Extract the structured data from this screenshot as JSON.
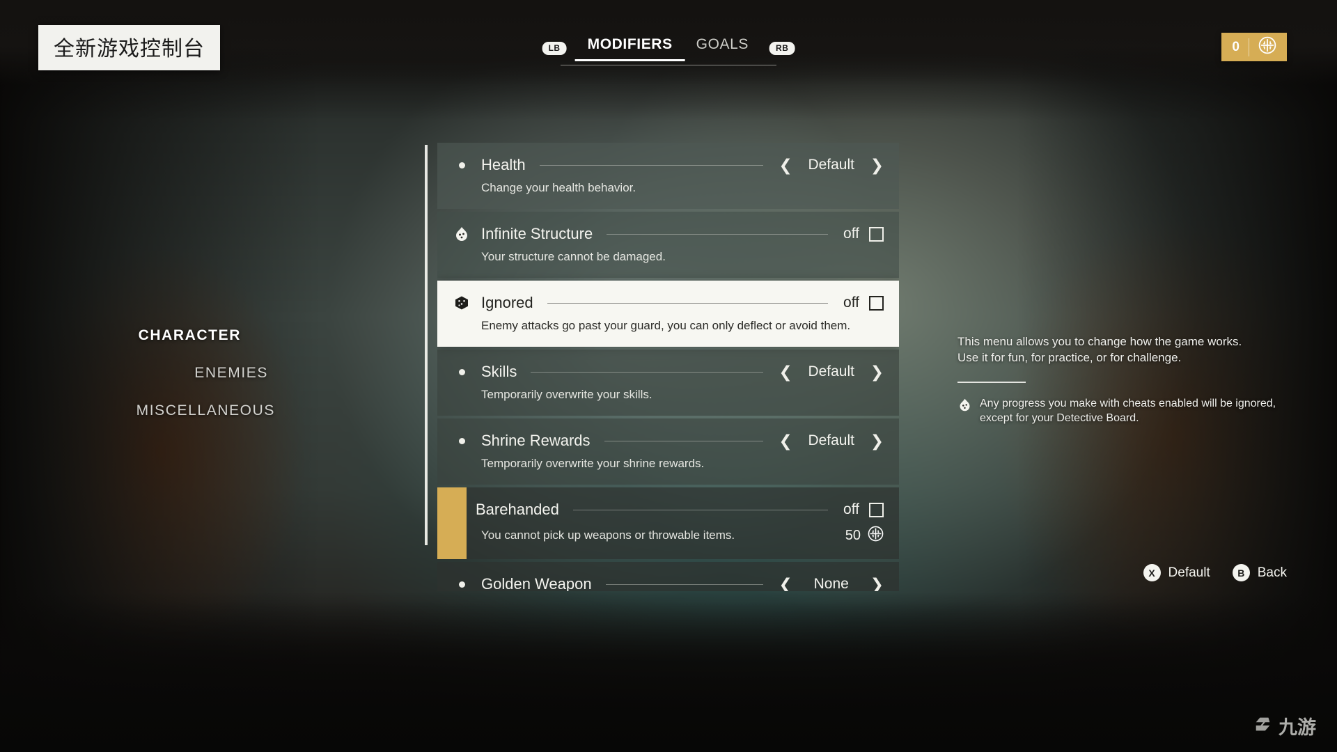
{
  "header": {
    "title_badge": "全新游戏控制台",
    "bumper_left": "LB",
    "bumper_right": "RB",
    "tabs": [
      {
        "label": "MODIFIERS",
        "active": true
      },
      {
        "label": "GOALS",
        "active": false
      }
    ],
    "currency": {
      "amount": "0",
      "icon": "coin-emblem-icon"
    },
    "accent_gold": "#d6ad55"
  },
  "sidebar": {
    "items": [
      {
        "label": "CHARACTER",
        "active": true
      },
      {
        "label": "ENEMIES",
        "active": false
      },
      {
        "label": "MISCELLANEOUS",
        "active": false
      }
    ]
  },
  "modifiers": [
    {
      "title": "Health",
      "description": "Change your health behavior.",
      "icon": "bullet-dot-icon",
      "control": "stepper",
      "value": "Default",
      "left_arrow": "❮",
      "right_arrow": "❯",
      "selected": false,
      "cost": null
    },
    {
      "title": "Infinite Structure",
      "description": "Your structure cannot be damaged.",
      "icon": "cheat-dice-flame-icon",
      "control": "toggle",
      "value": "off",
      "selected": false,
      "cost": null
    },
    {
      "title": "Ignored",
      "description": "Enemy attacks go past your guard, you can only deflect or avoid them.",
      "icon": "cheat-dice-icon",
      "control": "toggle",
      "value": "off",
      "selected": true,
      "cost": null
    },
    {
      "title": "Skills",
      "description": "Temporarily overwrite your skills.",
      "icon": "bullet-dot-icon",
      "control": "stepper",
      "value": "Default",
      "left_arrow": "❮",
      "right_arrow": "❯",
      "selected": false,
      "cost": null
    },
    {
      "title": "Shrine Rewards",
      "description": "Temporarily overwrite your shrine rewards.",
      "icon": "bullet-dot-icon",
      "control": "stepper",
      "value": "Default",
      "left_arrow": "❮",
      "right_arrow": "❯",
      "selected": false,
      "cost": null
    },
    {
      "title": "Barehanded",
      "description": "You cannot pick up weapons or throwable items.",
      "icon": "cheat-dice-icon",
      "control": "toggle",
      "value": "off",
      "selected": false,
      "highlighted_bar": true,
      "cost": "50"
    },
    {
      "title": "Golden Weapon",
      "description": "",
      "icon": "bullet-dot-icon",
      "control": "stepper",
      "value": "None",
      "left_arrow": "❮",
      "right_arrow": "❯",
      "selected": false,
      "clipped": true,
      "cost": null
    }
  ],
  "info_panel": {
    "line1": "This menu allows you to change how the game works.",
    "line2": "Use it for fun, for practice, or for challenge.",
    "note_icon": "cheat-dice-flame-icon",
    "note": "Any progress you make with cheats enabled will be ignored, except for your Detective Board."
  },
  "prompts": [
    {
      "key": "X",
      "label": "Default"
    },
    {
      "key": "B",
      "label": "Back"
    }
  ],
  "watermark": {
    "text": "九游"
  }
}
